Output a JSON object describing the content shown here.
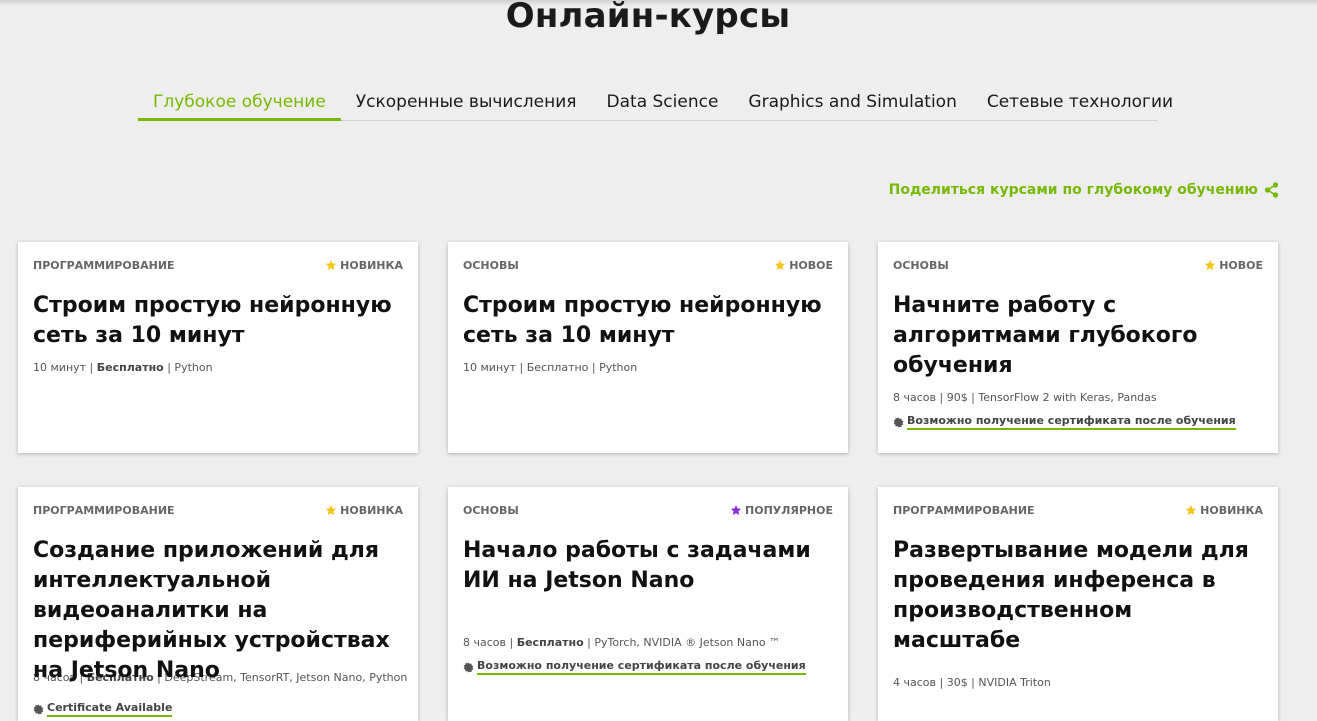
{
  "page": {
    "title": "Онлайн-курсы"
  },
  "tabs": [
    {
      "label": "Глубокое обучение"
    },
    {
      "label": "Ускоренные вычисления"
    },
    {
      "label": "Data Science"
    },
    {
      "label": "Graphics and Simulation"
    },
    {
      "label": "Сетевые технологии"
    }
  ],
  "share": {
    "label": "Поделиться курсами по глубокому обучению",
    "icon": "share-icon"
  },
  "colors": {
    "accent": "#76b900",
    "star_gold": "#f5c518",
    "star_purple": "#8a2be2"
  },
  "cards": [
    {
      "category": "ПРОГРАММИРОВАНИЕ",
      "badge": "НОВИНКА",
      "badge_icon": "star-icon",
      "title": "Строим простую нейронную сеть за 10 минут",
      "meta_a": "10 минут | ",
      "meta_bold": "Бесплатно",
      "meta_b": " | Python"
    },
    {
      "category": "ОСНОВЫ",
      "badge": "НОВОЕ",
      "badge_icon": "star-icon",
      "title": "Строим простую нейронную сеть за 10 минут",
      "meta_a": "10 минут | Бесплатно | Python"
    },
    {
      "category": "ОСНОВЫ",
      "badge": "НОВОЕ",
      "badge_icon": "star-icon",
      "title": "Начните работу с алгоритмами глубокого обучения",
      "meta_a": "8 часов |   90$  |  TensorFlow 2 with Keras, Pandas",
      "cert": "Возможно получение сертификата после обучения"
    },
    {
      "category": "ПРОГРАММИРОВАНИЕ",
      "badge": "НОВИНКА",
      "badge_icon": "star-icon",
      "title": "Создание приложений для интеллектуальной видеоаналитки на периферийных устройствах на Jetson Nano",
      "meta_a": "8 часов | ",
      "meta_bold": "Бесплатно",
      "meta_b": " | DeepStream, TensorRT, Jetson Nano, Python",
      "cert": "Certificate Available"
    },
    {
      "category": "ОСНОВЫ",
      "badge": "ПОПУЛЯРНОЕ",
      "badge_icon": "star-icon",
      "title": "Начало работы с задачами ИИ на Jetson Nano",
      "meta_a": "8 часов |  ",
      "meta_bold": "Бесплатно",
      "meta_b": " |  PyTorch, NVIDIA ® Jetson Nano ™",
      "cert": "Возможно получение сертификата после обучения"
    },
    {
      "category": "ПРОГРАММИРОВАНИЕ",
      "badge": "НОВИНКА",
      "badge_icon": "star-icon",
      "title": "Развертывание модели для проведения инференса в производственном масштабе",
      "meta_a": "4 часов | 30$ | NVIDIA Triton"
    }
  ]
}
